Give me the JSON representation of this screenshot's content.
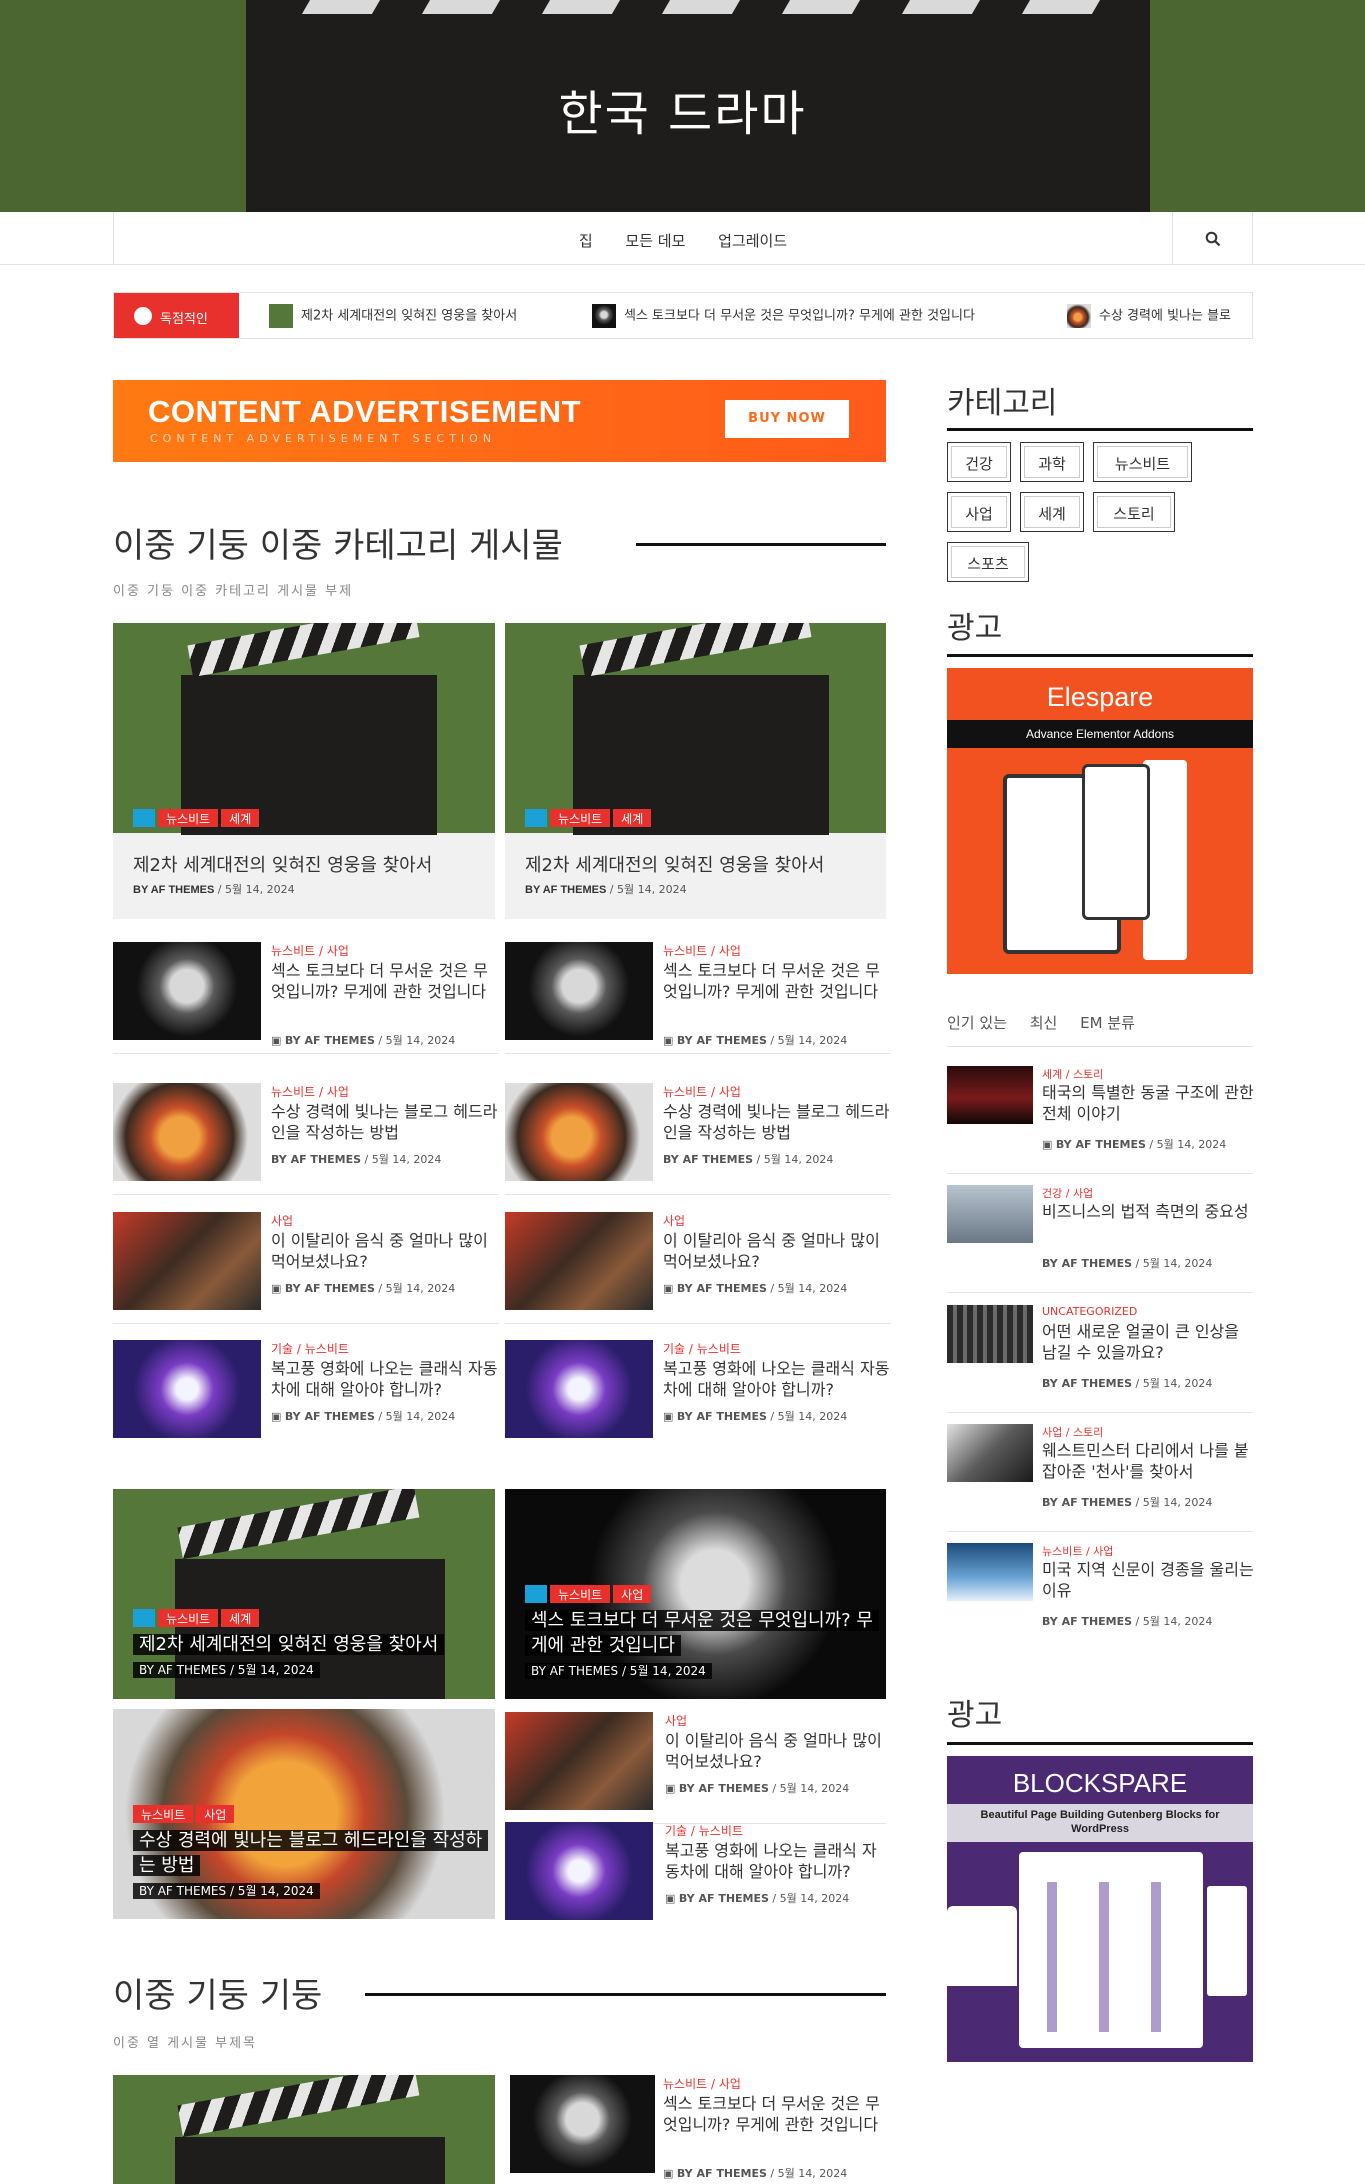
{
  "header": {
    "site_title": "한국 드라마"
  },
  "nav": {
    "items": [
      "집",
      "모든 데모",
      "업그레이드"
    ],
    "search_icon": "search-icon"
  },
  "ticker": {
    "label": "독점적인",
    "items": [
      "제2차 세계대전의 잊혀진 영웅을 찾아서",
      "섹스 토크보다 더 무서운 것은 무엇입니까? 무게에 관한 것입니다",
      "수상 경력에 빛나는 블로"
    ]
  },
  "ad_top": {
    "headline": "CONTENT ADVERTISEMENT",
    "sub": "CONTENT ADVERTISEMENT SECTION",
    "button": "BUY NOW"
  },
  "section1": {
    "title": "이중 기둥 이중 카테고리 게시물",
    "subtitle": "이중 기둥 이중 카테고리 게시물 부제",
    "featured": [
      {
        "tags": [
          "뉴스비트",
          "세계"
        ],
        "title": "제2차 세계대전의 잊혀진 영웅을 찾아서",
        "by": "BY AF THEMES",
        "date": "5월 14, 2024"
      },
      {
        "tags": [
          "뉴스비트",
          "세계"
        ],
        "title": "제2차 세계대전의 잊혀진 영웅을 찾아서",
        "by": "BY AF THEMES",
        "date": "5월 14, 2024"
      }
    ],
    "list": [
      {
        "cats": "뉴스비트 / 사업",
        "title": "섹스 토크보다 더 무서운 것은 무엇입니까? 무게에 관한 것입니다",
        "by": "BY AF THEMES",
        "date": "5월 14, 2024"
      },
      {
        "cats": "뉴스비트 / 사업",
        "title": "수상 경력에 빛나는 블로그 헤드라인을 작성하는 방법",
        "by": "BY AF THEMES",
        "date": "5월 14, 2024"
      },
      {
        "cats": "사업",
        "title": "이 이탈리아 음식 중 얼마나 많이 먹어보셨나요?",
        "by": "BY AF THEMES",
        "date": "5월 14, 2024"
      },
      {
        "cats": "기술 / 뉴스비트",
        "title": "복고풍 영화에 나오는 클래식 자동차에 대해 알아야 합니까?",
        "by": "BY AF THEMES",
        "date": "5월 14, 2024"
      }
    ]
  },
  "section2": {
    "tiles": [
      {
        "tags": [
          "뉴스비트",
          "세계"
        ],
        "title": "제2차 세계대전의 잊혀진 영웅을 찾아서",
        "meta": "BY AF THEMES / 5월 14, 2024"
      },
      {
        "tags": [
          "뉴스비트",
          "사업"
        ],
        "title": "섹스 토크보다 더 무서운 것은 무엇입니까? 무게에 관한 것입니다",
        "meta": "BY AF THEMES / 5월 14, 2024"
      },
      {
        "tags": [
          "뉴스비트",
          "사업"
        ],
        "title": "수상 경력에 빛나는 블로그 헤드라인을 작성하는 방법",
        "meta": "BY AF THEMES / 5월 14, 2024"
      }
    ],
    "list": [
      {
        "cats": "사업",
        "title": "이 이탈리아 음식 중 얼마나 많이 먹어보셨나요?",
        "by": "BY AF THEMES",
        "date": "5월 14, 2024"
      },
      {
        "cats": "기술 / 뉴스비트",
        "title": "복고풍 영화에 나오는 클래식 자동차에 대해 알아야 합니까?",
        "by": "BY AF THEMES",
        "date": "5월 14, 2024"
      }
    ]
  },
  "section3": {
    "title": "이중 기둥 기둥",
    "subtitle": "이중 열 게시물 부제목",
    "list": [
      {
        "cats": "뉴스비트 / 사업",
        "title": "섹스 토크보다 더 무서운 것은 무엇입니까? 무게에 관한 것입니다",
        "by": "BY AF THEMES",
        "date": "5월 14, 2024"
      }
    ]
  },
  "sidebar": {
    "categories_title": "카테고리",
    "categories": [
      "건강",
      "과학",
      "뉴스비트",
      "사업",
      "세계",
      "스토리",
      "스포츠"
    ],
    "ad_title": "광고",
    "elespare": {
      "name": "Elespare",
      "tagline": "Advance Elementor Addons"
    },
    "tabs": [
      "인기 있는",
      "최신",
      "EM 분류"
    ],
    "posts": [
      {
        "cats": "세계 / 스토리",
        "title": "태국의 특별한 동굴 구조에 관한 전체 이야기",
        "by": "BY AF THEMES",
        "date": "5월 14, 2024"
      },
      {
        "cats": "건강 / 사업",
        "title": "비즈니스의 법적 측면의 중요성",
        "by": "BY AF THEMES",
        "date": "5월 14, 2024"
      },
      {
        "cats": "UNCATEGORIZED",
        "title": "어떤 새로운 얼굴이 큰 인상을 남길 수 있을까요?",
        "by": "BY AF THEMES",
        "date": "5월 14, 2024"
      },
      {
        "cats": "사업 / 스토리",
        "title": "웨스트민스터 다리에서 나를 붙잡아준 '천사'를 찾아서",
        "by": "BY AF THEMES",
        "date": "5월 14, 2024"
      },
      {
        "cats": "뉴스비트 / 사업",
        "title": "미국 지역 신문이 경종을 울리는 이유",
        "by": "BY AF THEMES",
        "date": "5월 14, 2024"
      }
    ],
    "ad_title_2": "광고",
    "blockspare": {
      "name": "BLOCKSPARE",
      "tagline": "Beautiful Page Building Gutenberg Blocks for WordPress"
    }
  },
  "colors": {
    "accent": "#e8312d",
    "tag_icon": "#1ba0d8",
    "ad_orange": "#ff6a1a",
    "elespare": "#f2521f",
    "blockspare": "#4b2a73"
  }
}
